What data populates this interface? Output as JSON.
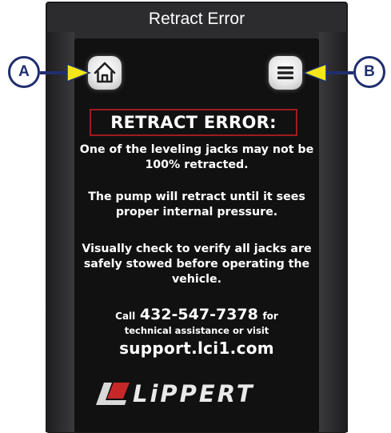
{
  "window": {
    "title": "Retract Error"
  },
  "toolbar": {
    "home_icon": "home-icon",
    "menu_icon": "hamburger-menu-icon"
  },
  "error": {
    "heading": "RETRACT ERROR:",
    "message_1": "One of the leveling jacks may not be 100% retracted.",
    "message_2": "The pump will retract until it sees proper internal pressure.",
    "message_3": "Visually check to verify all jacks are safely stowed before operating the vehicle."
  },
  "support": {
    "call_prefix": "Call",
    "phone": "432-547-7378",
    "call_suffix": "for",
    "line_2": "technical assistance or visit",
    "url": "support.lci1.com"
  },
  "brand": {
    "name": "LiPPERT",
    "accent": "#c62828"
  },
  "callouts": {
    "a": "A",
    "b": "B",
    "color": "#1f2f6f",
    "arrow_color": "#f5e61a"
  }
}
